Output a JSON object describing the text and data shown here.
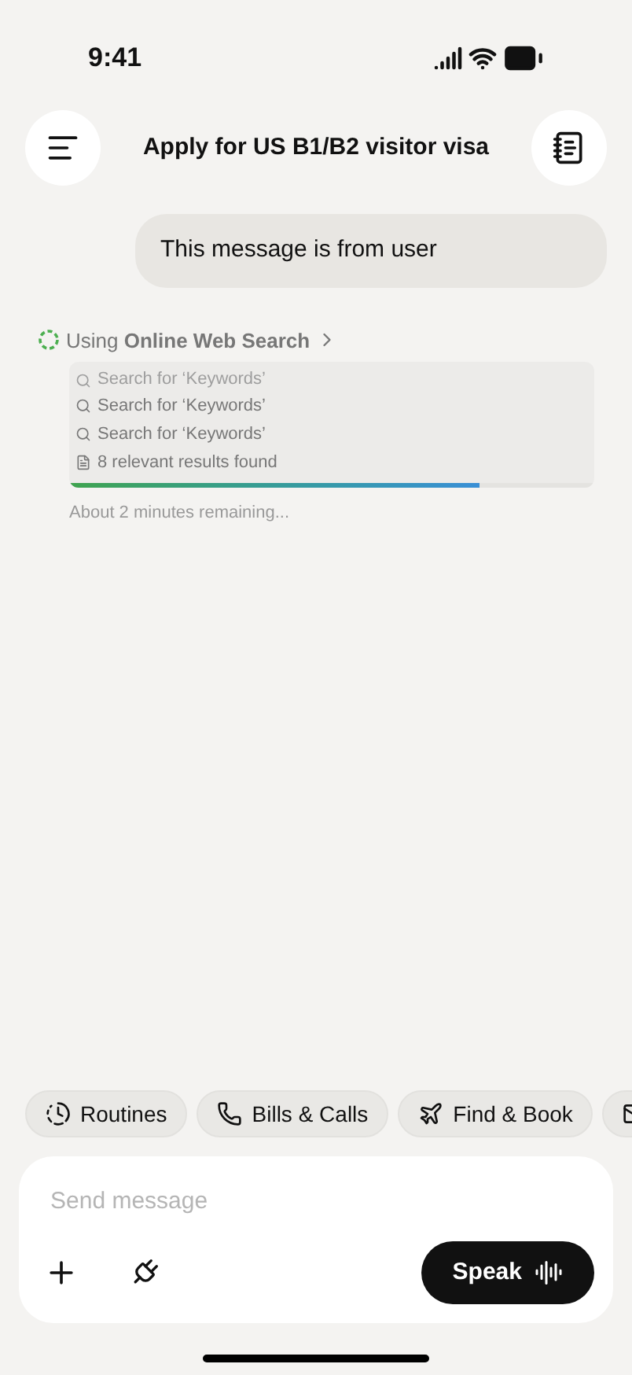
{
  "status_bar": {
    "time": "9:41"
  },
  "header": {
    "title": "Apply for US B1/B2 visitor visa"
  },
  "messages": [
    {
      "kind": "user",
      "text": "This message is from user"
    }
  ],
  "tool_activity": {
    "label": "Using **Online Web Search**",
    "steps": [
      {
        "kind": "search",
        "text": "Search for ‘Keywords’",
        "faded": true
      },
      {
        "kind": "search",
        "text": "Search for ‘Keywords’",
        "faded": false
      },
      {
        "kind": "search",
        "text": "Search for ‘Keywords’",
        "faded": false
      },
      {
        "kind": "document",
        "text": "8 relevant results found",
        "faded": false
      }
    ],
    "level": 0.78,
    "remaining": "About 2 minutes remaining..."
  },
  "chips": [
    {
      "kind": "routine",
      "label": "Routines"
    },
    {
      "kind": "phone",
      "label": "Bills & Calls"
    },
    {
      "kind": "plane",
      "label": "Find & Book"
    },
    {
      "kind": "mail"
    }
  ],
  "composer": {
    "placeholder": "Send message",
    "speak_label": "Speak"
  }
}
